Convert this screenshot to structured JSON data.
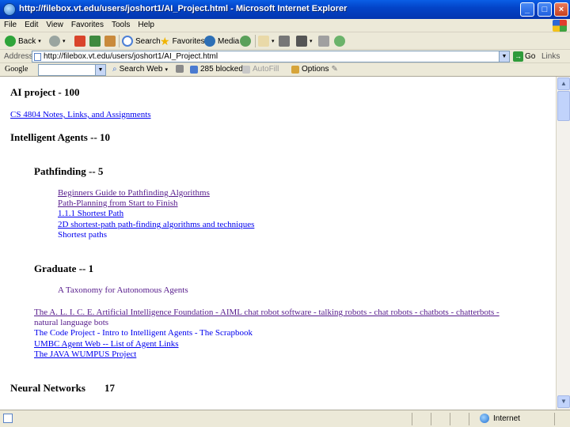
{
  "window": {
    "title": "http://filebox.vt.edu/users/joshort1/AI_Project.html - Microsoft Internet Explorer",
    "min": "_",
    "max": "□",
    "close": "×"
  },
  "menu": [
    "File",
    "Edit",
    "View",
    "Favorites",
    "Tools",
    "Help"
  ],
  "toolbar": {
    "back": "Back",
    "search": "Search",
    "favorites": "Favorites",
    "media": "Media"
  },
  "address": {
    "label": "Address",
    "url": "http://filebox.vt.edu/users/joshort1/AI_Project.html",
    "go": "Go",
    "links": "Links"
  },
  "google_bar": {
    "logo": "Google",
    "search_web": "Search Web",
    "blocked": "285 blocked",
    "autofill": "AutoFill",
    "options": "Options"
  },
  "page": {
    "title": "AI project - 100",
    "cs_link": "CS 4804 Notes, Links, and Assignments",
    "agents_heading": "Intelligent Agents -- 10",
    "pathfinding_heading": "Pathfinding -- 5",
    "pathfinding_links": [
      "Beginners Guide to Pathfinding Algorithms",
      "Path-Planning from Start to Finish",
      "1.1.1 Shortest Path",
      "2D shortest-path path-finding algorithms and techniques",
      "Shortest paths"
    ],
    "graduate_heading": "Graduate -- 1",
    "graduate_item": "A Taxonomy for Autonomous Agents",
    "agent_links": [
      "The A. L. I. C. E. Artificial Intelligence Foundation - AIML chat robot software - talking robots - chat robots - chatbots - chatterbots -",
      "natural language bots",
      "The Code Project - Intro to Intelligent Agents - The Scrapbook",
      "UMBC Agent Web -- List of Agent Links",
      "The JAVA WUMPUS Project"
    ],
    "neural_heading": "Neural Networks",
    "neural_score": "17"
  },
  "status": {
    "zone": "Internet"
  }
}
